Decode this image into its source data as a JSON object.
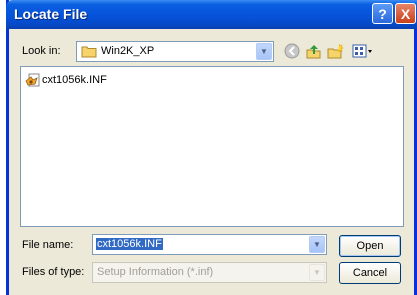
{
  "window": {
    "title": "Locate File"
  },
  "titlebar": {
    "help_symbol": "?",
    "close_symbol": "X"
  },
  "lookin": {
    "label": "Look in:",
    "value": "Win2K_XP"
  },
  "files": [
    {
      "name": "cxt1056k.INF"
    }
  ],
  "filename": {
    "label": "File name:",
    "value": "cxt1056k.INF"
  },
  "filetype": {
    "label": "Files of type:",
    "value": "Setup Information (*.inf)"
  },
  "buttons": {
    "open": "Open",
    "cancel": "Cancel"
  },
  "icons": {
    "folder": "folder-icon",
    "back": "back-icon",
    "up": "up-folder-icon",
    "new_folder": "new-folder-icon",
    "view": "view-menu-icon",
    "file": "setup-file-icon"
  },
  "colors": {
    "titlebar": "#0654dc",
    "face": "#ece9d8",
    "selection": "#316ac5"
  }
}
